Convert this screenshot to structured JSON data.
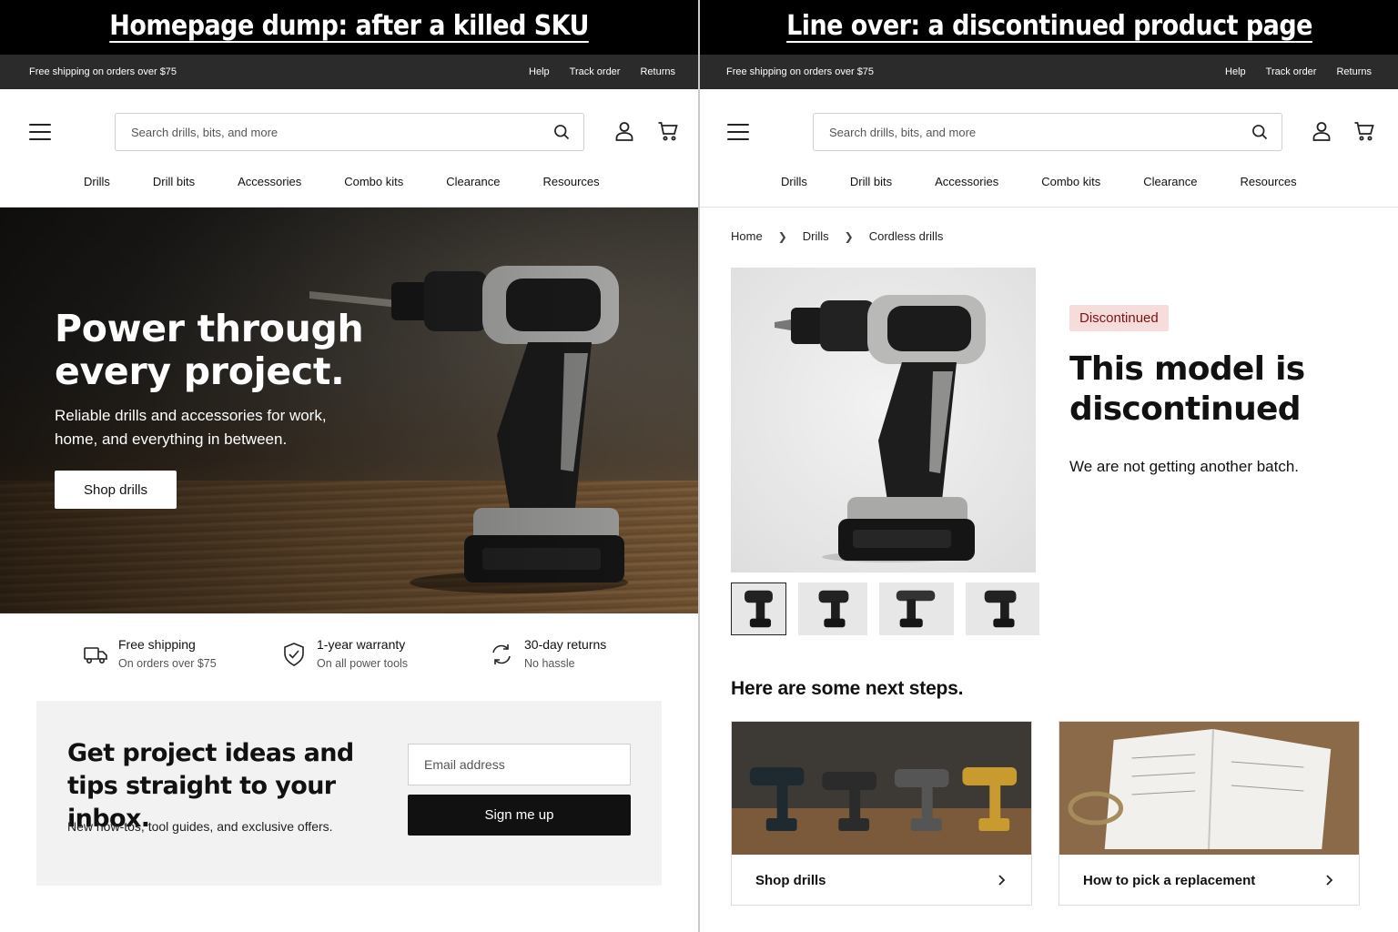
{
  "left": {
    "caption": "Homepage dump: after a killed SKU",
    "topbar": {
      "shipping": "Free shipping on orders over $75",
      "links": [
        "Help",
        "Track order",
        "Returns"
      ]
    },
    "search_placeholder": "Search drills, bits, and more",
    "nav": [
      "Drills",
      "Drill bits",
      "Accessories",
      "Combo kits",
      "Clearance",
      "Resources"
    ],
    "hero": {
      "title": "Power through every project.",
      "subtitle": "Reliable drills and accessories for work, home, and everything in between.",
      "cta": "Shop drills"
    },
    "benefits": [
      {
        "title": "Free shipping",
        "sub": "On orders over $75",
        "icon": "truck-icon"
      },
      {
        "title": "1-year warranty",
        "sub": "On all power tools",
        "icon": "shield-check-icon"
      },
      {
        "title": "30-day returns",
        "sub": "No hassle",
        "icon": "refresh-icon"
      }
    ],
    "newsletter": {
      "title": "Get project ideas and tips straight to your inbox.",
      "text": "New how-tos, tool guides, and exclusive offers.",
      "email_placeholder": "Email address",
      "button": "Sign me up"
    }
  },
  "right": {
    "caption": "Line over: a discontinued product page",
    "topbar": {
      "shipping": "Free shipping on orders over $75",
      "links": [
        "Help",
        "Track order",
        "Returns"
      ]
    },
    "search_placeholder": "Search drills, bits, and more",
    "nav": [
      "Drills",
      "Drill bits",
      "Accessories",
      "Combo kits",
      "Clearance",
      "Resources"
    ],
    "breadcrumb": [
      "Home",
      "Drills",
      "Cordless drills"
    ],
    "badge": "Discontinued",
    "title": "This model is discontinued",
    "text": "We are not getting another batch.",
    "next_title": "Here are some next steps.",
    "cards": [
      {
        "label": "Shop drills"
      },
      {
        "label": "How to pick a replacement"
      }
    ]
  },
  "colors": {
    "topbar": "#2b2b2b",
    "badge_bg": "#f7dcdc",
    "badge_text": "#7a1212",
    "button": "#111111"
  }
}
